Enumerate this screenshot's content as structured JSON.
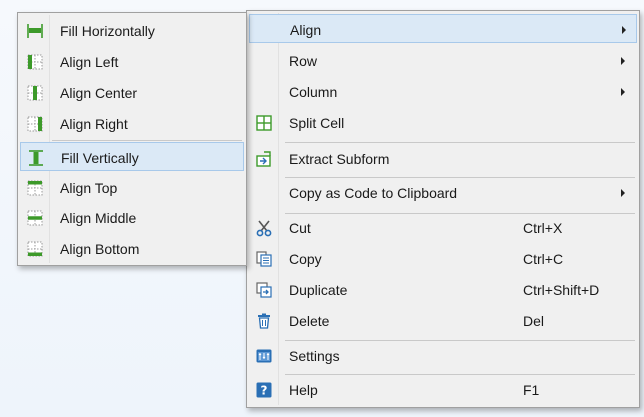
{
  "main_menu": {
    "items": [
      {
        "label": "Align",
        "icon": "none",
        "submenu": true,
        "highlighted": true
      },
      {
        "label": "Row",
        "icon": "none",
        "submenu": true
      },
      {
        "label": "Column",
        "icon": "none",
        "submenu": true
      },
      {
        "label": "Split Cell",
        "icon": "split-cell-icon"
      },
      {
        "label": "Extract Subform",
        "icon": "extract-subform-icon"
      },
      {
        "label": "Copy as Code to Clipboard",
        "icon": "none",
        "submenu": true
      },
      {
        "label": "Cut",
        "icon": "scissors-icon",
        "shortcut": "Ctrl+X"
      },
      {
        "label": "Copy",
        "icon": "copy-icon",
        "shortcut": "Ctrl+C"
      },
      {
        "label": "Duplicate",
        "icon": "duplicate-icon",
        "shortcut": "Ctrl+Shift+D"
      },
      {
        "label": "Delete",
        "icon": "trash-icon",
        "shortcut": "Del"
      },
      {
        "label": "Settings",
        "icon": "settings-icon"
      },
      {
        "label": "Help",
        "icon": "help-icon",
        "shortcut": "F1"
      }
    ]
  },
  "align_submenu": {
    "items": [
      {
        "label": "Fill Horizontally",
        "icon": "fill-horizontally-icon"
      },
      {
        "label": "Align Left",
        "icon": "align-left-icon"
      },
      {
        "label": "Align Center",
        "icon": "align-center-icon"
      },
      {
        "label": "Align Right",
        "icon": "align-right-icon"
      },
      {
        "label": "Fill Vertically",
        "icon": "fill-vertically-icon",
        "highlighted": true
      },
      {
        "label": "Align Top",
        "icon": "align-top-icon"
      },
      {
        "label": "Align Middle",
        "icon": "align-middle-icon"
      },
      {
        "label": "Align Bottom",
        "icon": "align-bottom-icon"
      }
    ]
  },
  "colors": {
    "menu_bg": "#f0f0f0",
    "highlight_bg": "#dbe9f6",
    "highlight_border": "#a8c9ea",
    "icon_green": "#3d9a2a",
    "icon_blue": "#2a6fb5"
  }
}
